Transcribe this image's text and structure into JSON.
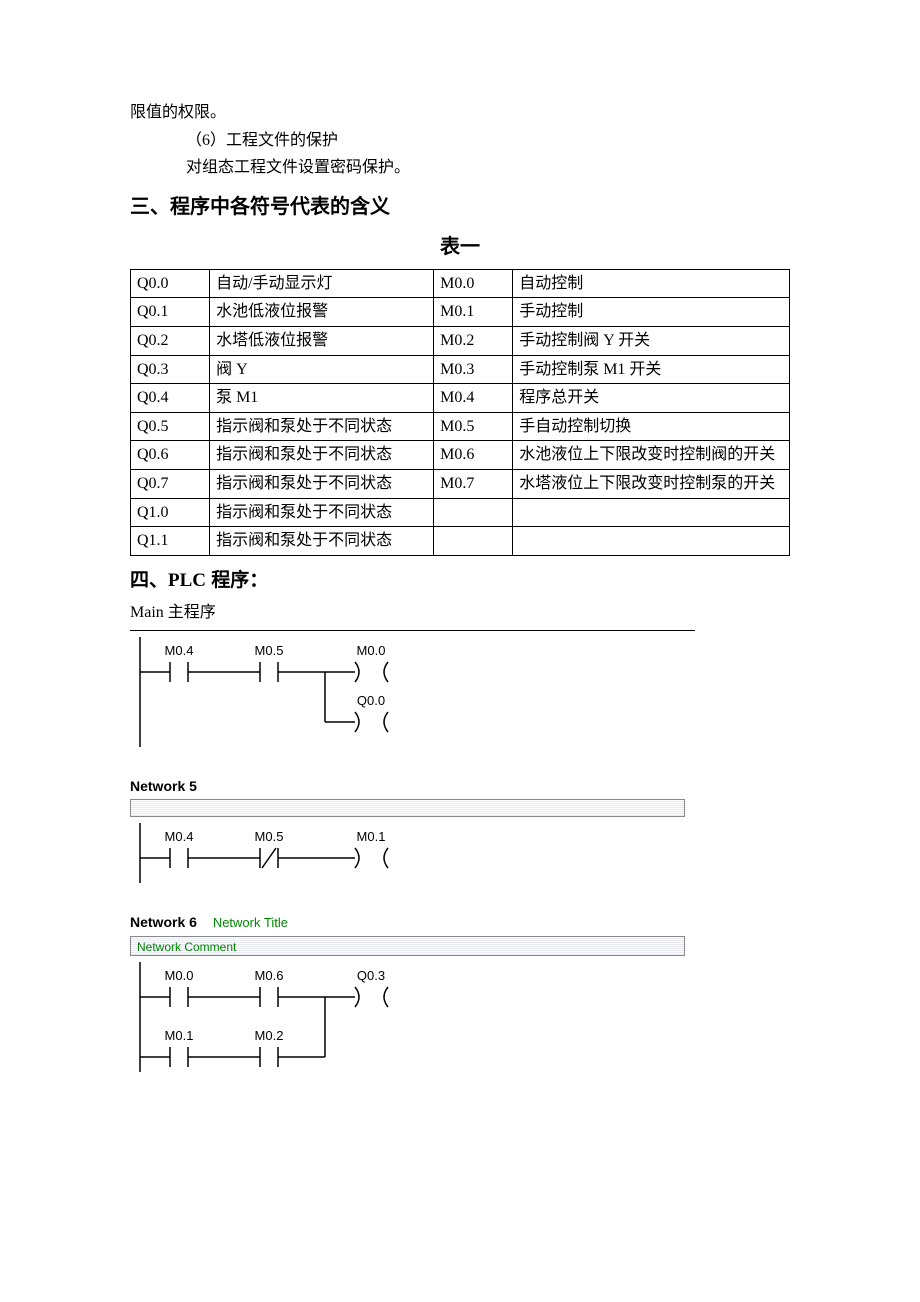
{
  "top_line": "限值的权限。",
  "item6_title": "（6）工程文件的保护",
  "item6_body": "对组态工程文件设置密码保护。",
  "heading3": "三、程序中各符号代表的含义",
  "table_caption": "表一",
  "table_rows": [
    {
      "c1": "Q0.0",
      "c2": "自动/手动显示灯",
      "c3": "M0.0",
      "c4": "自动控制"
    },
    {
      "c1": "Q0.1",
      "c2": "水池低液位报警",
      "c3": "M0.1",
      "c4": "手动控制"
    },
    {
      "c1": "Q0.2",
      "c2": "水塔低液位报警",
      "c3": "M0.2",
      "c4": "手动控制阀 Y 开关"
    },
    {
      "c1": "Q0.3",
      "c2": "阀 Y",
      "c3": "M0.3",
      "c4": "手动控制泵 M1 开关"
    },
    {
      "c1": "Q0.4",
      "c2": "泵 M1",
      "c3": "M0.4",
      "c4": "程序总开关"
    },
    {
      "c1": "Q0.5",
      "c2": "指示阀和泵处于不同状态",
      "c3": "M0.5",
      "c4": "手自动控制切换"
    },
    {
      "c1": "Q0.6",
      "c2": "指示阀和泵处于不同状态",
      "c3": "M0.6",
      "c4": "水池液位上下限改变时控制阀的开关"
    },
    {
      "c1": "Q0.7",
      "c2": "指示阀和泵处于不同状态",
      "c3": "M0.7",
      "c4": "水塔液位上下限改变时控制泵的开关"
    },
    {
      "c1": "Q1.0",
      "c2": "指示阀和泵处于不同状态",
      "c3": "",
      "c4": ""
    },
    {
      "c1": "Q1.1",
      "c2": "指示阀和泵处于不同状态",
      "c3": "",
      "c4": ""
    }
  ],
  "heading4_prefix": "四、",
  "heading4_latin": "PLC",
  "heading4_suffix": " 程序：",
  "main_program_label": "Main  主程序",
  "ladder": {
    "rung4": {
      "contacts": [
        "M0.4",
        "M0.5"
      ],
      "coils": [
        "M0.0",
        "Q0.0"
      ]
    },
    "net5_label": "Network 5",
    "rung5": {
      "contacts": [
        "M0.4",
        "M0.5"
      ],
      "contact2_type": "nc",
      "coils": [
        "M0.1"
      ]
    },
    "net6_label": "Network 6",
    "net6_title": "Network Title",
    "net6_comment": "Network Comment",
    "rung6": {
      "branch1": [
        "M0.0",
        "M0.6"
      ],
      "branch2": [
        "M0.1",
        "M0.2"
      ],
      "coil": "Q0.3"
    }
  }
}
